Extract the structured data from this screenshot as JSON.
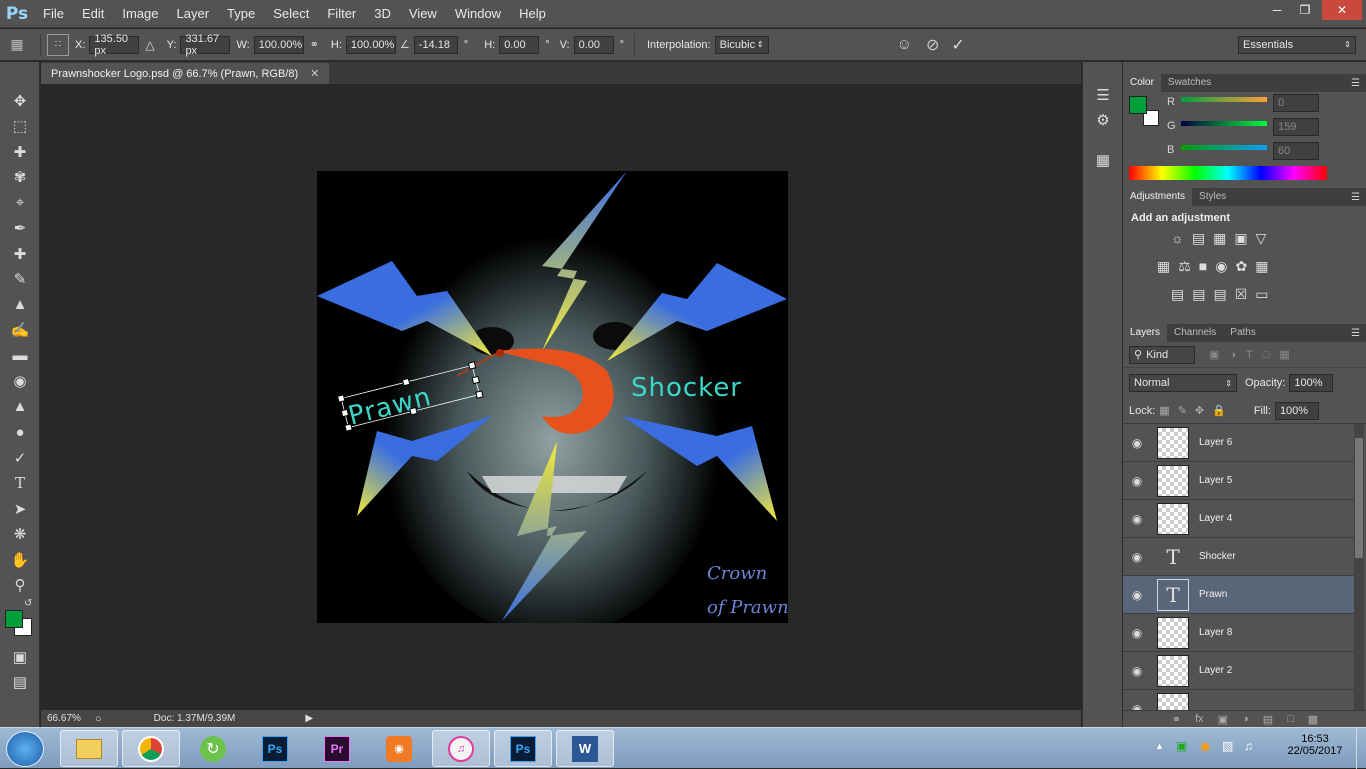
{
  "app": {
    "logo": "Ps"
  },
  "menu": [
    "File",
    "Edit",
    "Image",
    "Layer",
    "Type",
    "Select",
    "Filter",
    "3D",
    "View",
    "Window",
    "Help"
  ],
  "options": {
    "x_label": "X:",
    "x_value": "135.50 px",
    "y_label": "Y:",
    "y_value": "331.67 px",
    "w_label": "W:",
    "w_value": "100.00%",
    "h_label": "H:",
    "h_value": "100.00%",
    "angle_value": "-14.18",
    "angle_unit": "°",
    "hskew_label": "H:",
    "hskew_value": "0.00",
    "hskew_unit": "°",
    "vskew_label": "V:",
    "vskew_value": "0.00",
    "vskew_unit": "°",
    "interp_label": "Interpolation:",
    "interp_value": "Bicubic",
    "workspace": "Essentials"
  },
  "document": {
    "tab_title": "Prawnshocker Logo.psd @ 66.7% (Prawn, RGB/8)",
    "art_text_left": "Prawn",
    "art_text_right": "Shocker",
    "art_credit_line1": "Crown",
    "art_credit_line2": "of Prawns"
  },
  "status": {
    "zoom": "66.67%",
    "doc": "Doc: 1.37M/9.39M"
  },
  "color_panel": {
    "tabs": [
      "Color",
      "Swatches"
    ],
    "r_label": "R",
    "r_value": "0",
    "g_label": "G",
    "g_value": "159",
    "b_label": "B",
    "b_value": "60",
    "foreground": "#009f3c"
  },
  "adjustments": {
    "tabs": [
      "Adjustments",
      "Styles"
    ],
    "heading": "Add an adjustment"
  },
  "layers": {
    "tabs": [
      "Layers",
      "Channels",
      "Paths"
    ],
    "filter": "Kind",
    "blend_mode": "Normal",
    "opacity_label": "Opacity:",
    "opacity_value": "100%",
    "lock_label": "Lock:",
    "fill_label": "Fill:",
    "fill_value": "100%",
    "items": [
      {
        "name": "Layer 6",
        "kind": "pixel"
      },
      {
        "name": "Layer 5",
        "kind": "pixel"
      },
      {
        "name": "Layer 4",
        "kind": "pixel"
      },
      {
        "name": "Shocker",
        "kind": "text"
      },
      {
        "name": "Prawn",
        "kind": "text",
        "selected": true
      },
      {
        "name": "Layer 8",
        "kind": "pixel"
      },
      {
        "name": "Layer 2",
        "kind": "pixel"
      }
    ]
  },
  "taskbar": {
    "time": "16:53",
    "date": "22/05/2017"
  }
}
